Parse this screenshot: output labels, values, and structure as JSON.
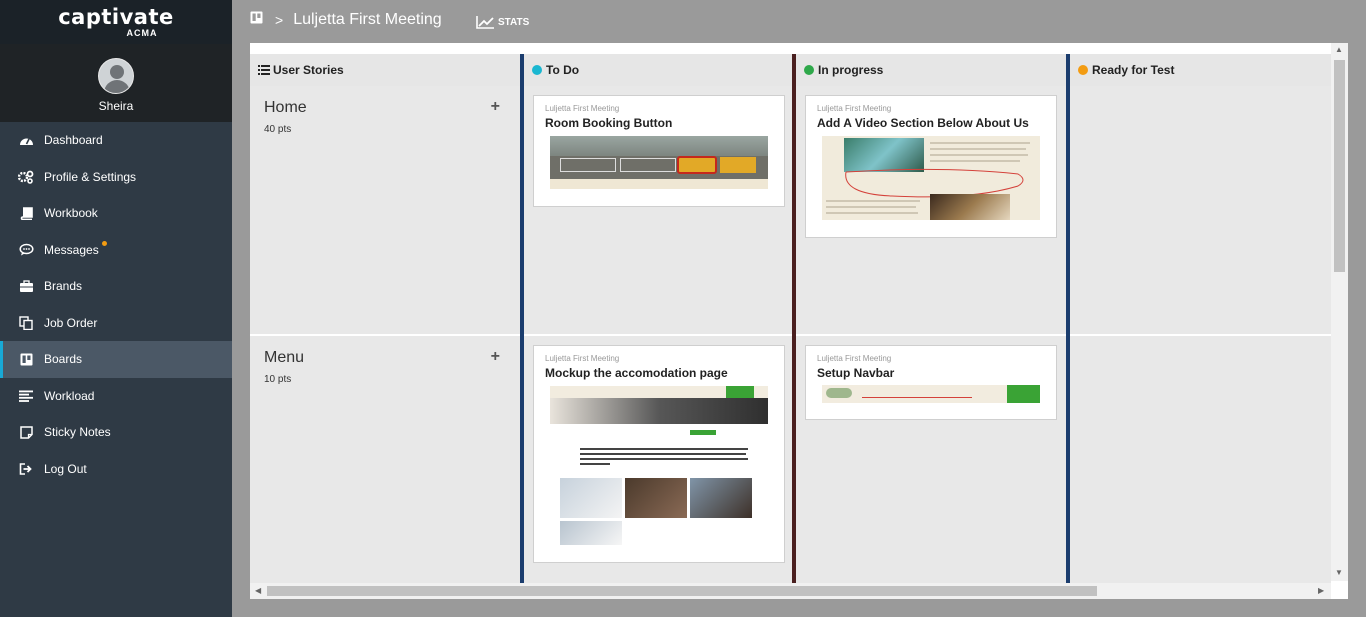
{
  "app": {
    "logo": "captivate",
    "logo_sub": "ACMA"
  },
  "user": {
    "name": "Sheira"
  },
  "nav": [
    {
      "label": "Dashboard",
      "icon": "dashboard-icon"
    },
    {
      "label": "Profile & Settings",
      "icon": "gears-icon"
    },
    {
      "label": "Workbook",
      "icon": "book-icon"
    },
    {
      "label": "Messages",
      "icon": "chat-icon",
      "badge": true
    },
    {
      "label": "Brands",
      "icon": "briefcase-icon"
    },
    {
      "label": "Job Order",
      "icon": "copy-icon"
    },
    {
      "label": "Boards",
      "icon": "trello-icon",
      "active": true
    },
    {
      "label": "Workload",
      "icon": "list-icon"
    },
    {
      "label": "Sticky Notes",
      "icon": "note-icon"
    },
    {
      "label": "Log Out",
      "icon": "sign-out-icon"
    }
  ],
  "breadcrumb": {
    "title": "Luljetta First Meeting",
    "separator": ">"
  },
  "stats_label": "STATS",
  "columns": [
    {
      "label": "User Stories"
    },
    {
      "label": "To Do",
      "color": "#1ab7d1"
    },
    {
      "label": "In progress",
      "color": "#2ea84a"
    },
    {
      "label": "Ready for Test",
      "color": "#f39c12"
    }
  ],
  "stories": [
    {
      "title": "Home",
      "pts": "40 pts"
    },
    {
      "title": "Menu",
      "pts": "10 pts"
    }
  ],
  "cards": [
    {
      "project": "Luljetta First Meeting",
      "title": "Room Booking Button"
    },
    {
      "project": "Luljetta First Meeting",
      "title": "Add A Video Section Below About Us"
    },
    {
      "project": "Luljetta First Meeting",
      "title": "Mockup the accomodation page"
    },
    {
      "project": "Luljetta First Meeting",
      "title": "Setup Navbar"
    }
  ],
  "colors": {
    "sidebar": "#2f3a45",
    "active": "#4b5866",
    "accent": "#18a9d6"
  }
}
